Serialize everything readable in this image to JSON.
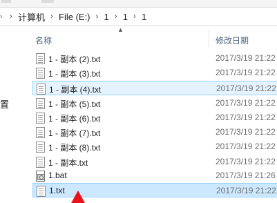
{
  "address_bar": {
    "crumbs": [
      "计算机",
      "File (E:)",
      "1",
      "1",
      "1"
    ]
  },
  "nav_pane": {
    "partial_label": "置"
  },
  "header": {
    "name_col": "名称",
    "date_col": "修改日期"
  },
  "files": [
    {
      "name": "1 - 副本 (2).txt",
      "date": "2017/3/19 21:22",
      "icon": "text-file-icon"
    },
    {
      "name": "1 - 副本 (3).txt",
      "date": "2017/3/19 21:22",
      "icon": "text-file-icon"
    },
    {
      "name": "1 - 副本 (4).txt",
      "date": "2017/3/19 21:22",
      "icon": "text-file-icon"
    },
    {
      "name": "1 - 副本 (5).txt",
      "date": "2017/3/19 21:22",
      "icon": "text-file-icon"
    },
    {
      "name": "1 - 副本 (6).txt",
      "date": "2017/3/19 21:22",
      "icon": "text-file-icon"
    },
    {
      "name": "1 - 副本 (7).txt",
      "date": "2017/3/19 21:22",
      "icon": "text-file-icon"
    },
    {
      "name": "1 - 副本 (8).txt",
      "date": "2017/3/19 21:22",
      "icon": "text-file-icon"
    },
    {
      "name": "1 - 副本.txt",
      "date": "2017/3/19 21:22",
      "icon": "text-file-icon"
    },
    {
      "name": "1.bat",
      "date": "2017/3/19 21:26",
      "icon": "batch-file-icon"
    },
    {
      "name": "1.txt",
      "date": "2017/3/19 21:22",
      "icon": "text-file-icon"
    }
  ],
  "colors": {
    "selection_bg": "#cce8ff",
    "selection_border": "#99d1ff",
    "annotation_arrow": "#e8121a"
  }
}
